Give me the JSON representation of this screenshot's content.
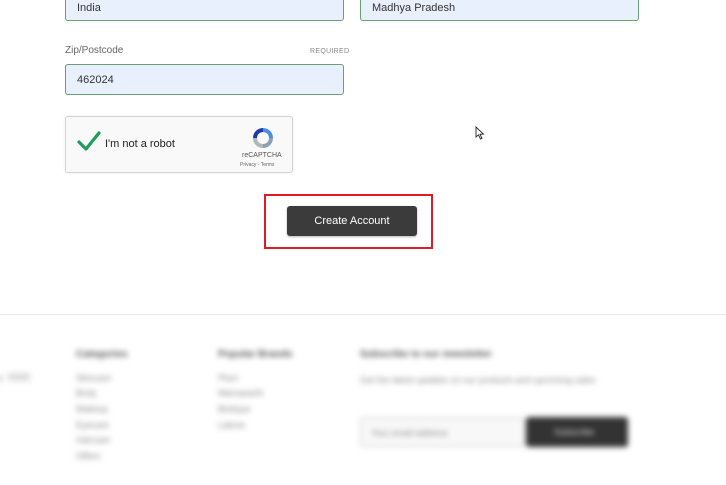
{
  "form": {
    "country_value": "India",
    "state_value": "Madhya Pradesh",
    "zip_label": "Zip/Postcode",
    "zip_required": "REQUIRED",
    "zip_value": "462024"
  },
  "recaptcha": {
    "checked": true,
    "label": "I'm not a robot",
    "brand": "reCAPTCHA",
    "links": "Privacy - Terms"
  },
  "submit": {
    "label": "Create Account"
  },
  "footer": {
    "left_fragment": "e",
    "categories_heading": "Categories",
    "categories": [
      "Skincare",
      "Body",
      "Makeup",
      "Eyecare",
      "Haircare",
      "Offers"
    ],
    "brands_heading": "Popular Brands",
    "brands": [
      "Plum",
      "Mamaearth",
      "Biotique",
      "Lakme"
    ],
    "newsletter_heading": "Subscribe to our newsletter",
    "newsletter_text": "Get the latest updates on our products and upcoming sales",
    "newsletter_placeholder": "Your email address",
    "newsletter_button": "Subscribe"
  }
}
